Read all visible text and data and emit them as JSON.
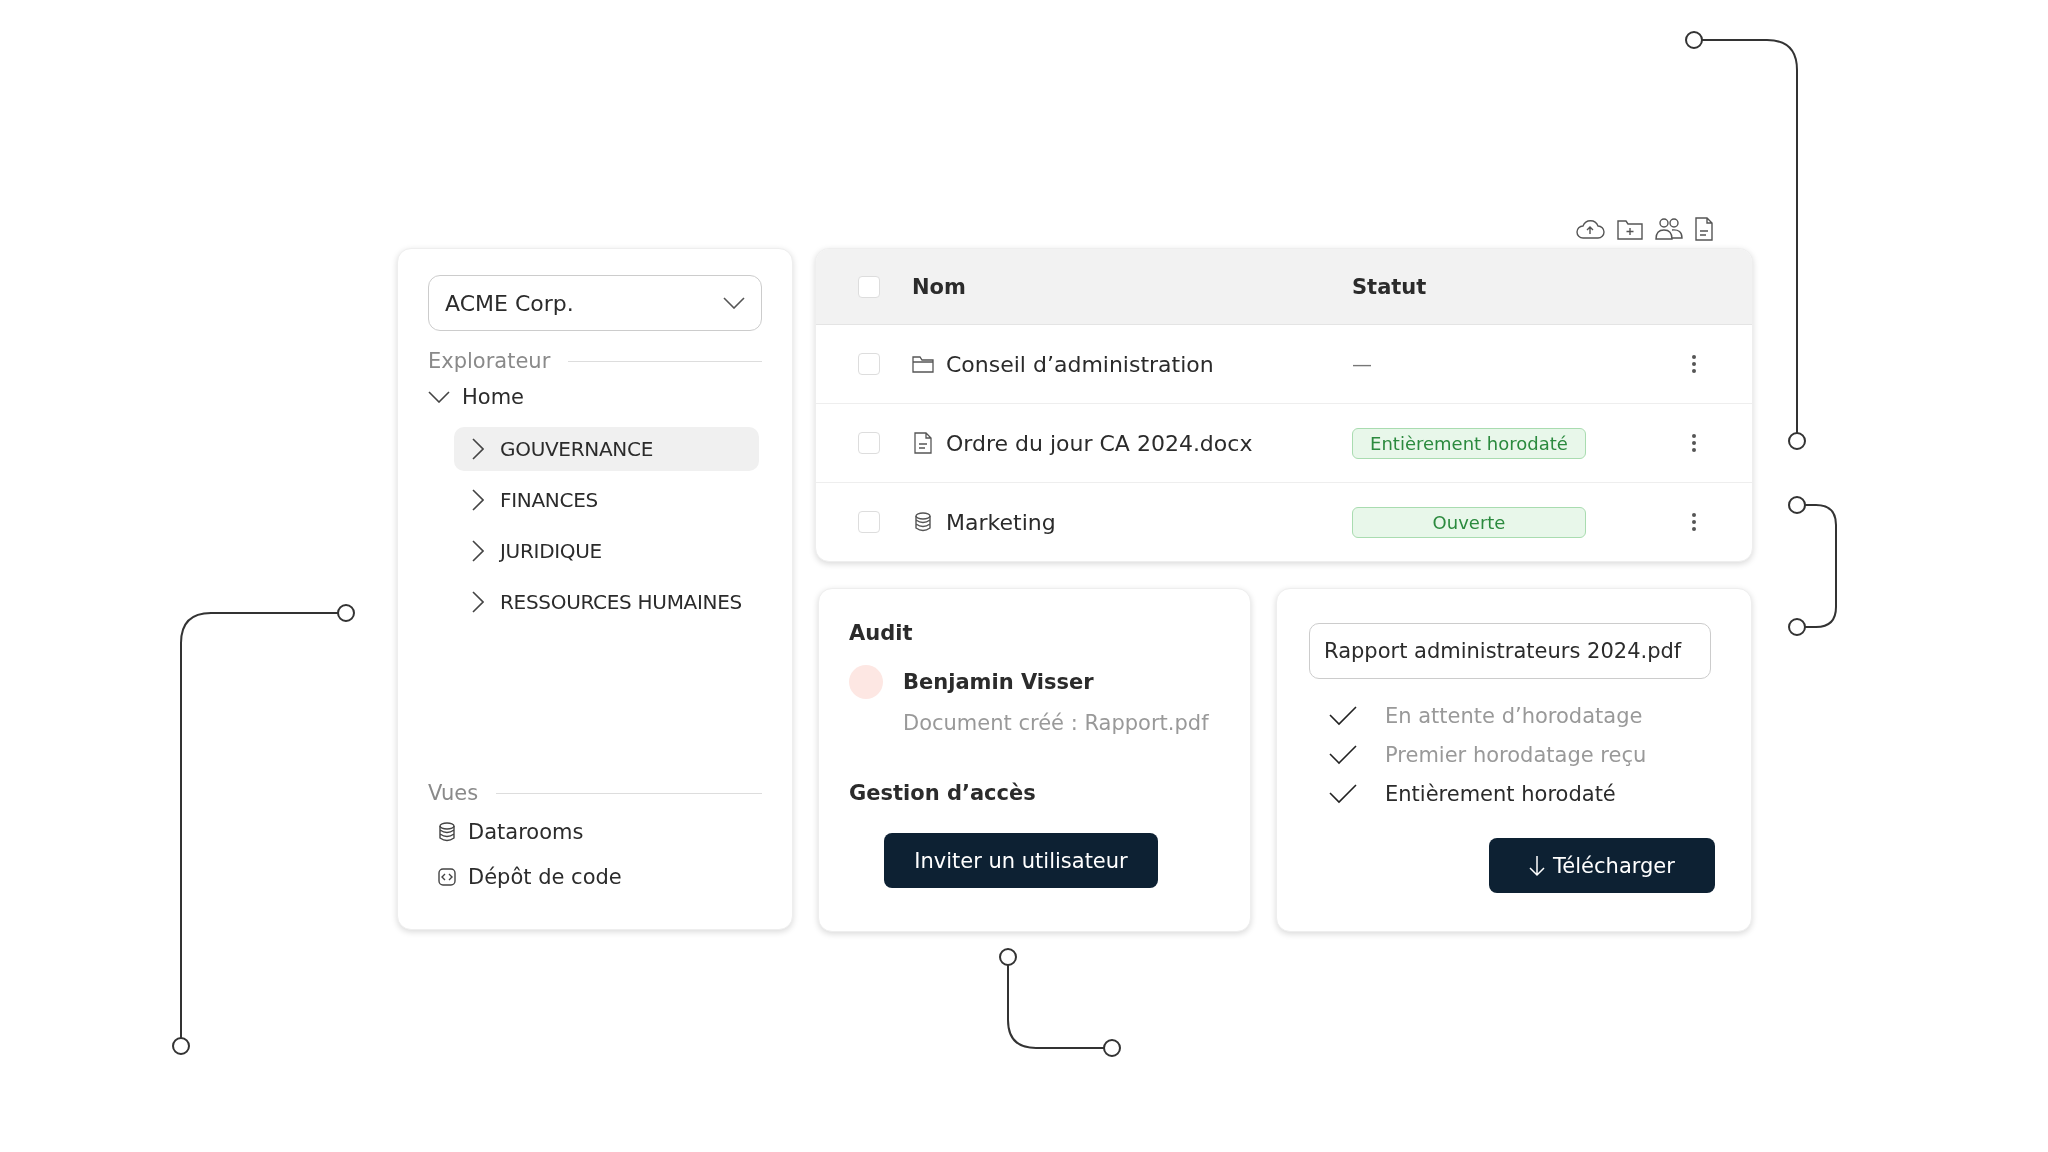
{
  "sidebar": {
    "company_select": {
      "value": "ACME Corp."
    },
    "explorer_label": "Explorateur",
    "tree": [
      {
        "label": "Home",
        "expanded": true,
        "selected": false,
        "children": [
          {
            "label": "GOUVERNANCE",
            "expanded": false,
            "selected": true
          },
          {
            "label": "FINANCES",
            "expanded": false,
            "selected": false
          },
          {
            "label": "JURIDIQUE",
            "expanded": false,
            "selected": false
          },
          {
            "label": "RESSOURCES HUMAINES",
            "expanded": false,
            "selected": false
          }
        ]
      }
    ],
    "views_label": "Vues",
    "views": [
      {
        "label": "Datarooms",
        "kind": "database"
      },
      {
        "label": "Dépôt de code",
        "kind": "code"
      }
    ]
  },
  "toolbar": [
    {
      "kind": "upload"
    },
    {
      "kind": "new-folder"
    },
    {
      "kind": "users"
    },
    {
      "kind": "document"
    }
  ],
  "table": {
    "columns": [
      "Nom",
      "Statut"
    ],
    "header_checked": false,
    "rows": [
      {
        "kind": "folder",
        "name": "Conseil d’administration",
        "status": {
          "kind": "none",
          "text": "—"
        },
        "checked": false
      },
      {
        "kind": "file",
        "name": "Ordre du jour CA 2024.docx",
        "status": {
          "kind": "badge",
          "text": "Entièrement horodaté"
        },
        "checked": false
      },
      {
        "kind": "database",
        "name": "Marketing",
        "status": {
          "kind": "badge",
          "text": "Ouverte"
        },
        "checked": false
      }
    ]
  },
  "audit": {
    "title": "Audit",
    "user": "Benjamin Visser",
    "event": "Document créé : Rapport.pdf",
    "access_title": "Gestion d’accès",
    "invite_button": "Inviter un utilisateur"
  },
  "timestamp": {
    "file_name": "Rapport administrateurs 2024.pdf",
    "steps": [
      {
        "label": "En attente d’horodatage",
        "current": false
      },
      {
        "label": "Premier horodatage reçu",
        "current": false
      },
      {
        "label": "Entièrement horodaté",
        "current": true
      }
    ],
    "download_button": "Télécharger"
  }
}
